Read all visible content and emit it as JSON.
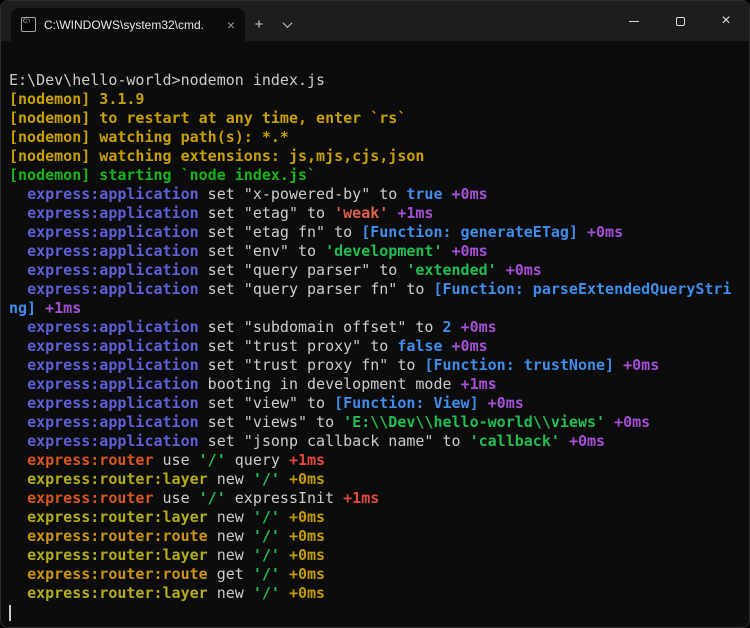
{
  "window": {
    "tab": {
      "title": "C:\\WINDOWS\\system32\\cmd.",
      "icon_label": "C:\\",
      "close_label": "×"
    },
    "controls": {
      "new_tab_label": "+",
      "close_label": "×"
    },
    "icons": {
      "tab_icon": "cmd-prompt-window",
      "dropdown": "chevron-down",
      "minimize": "horizontal-bar",
      "maximize": "outline-square",
      "close": "×"
    }
  },
  "palette": {
    "fg": "#cccccc",
    "yellow": "#c7a000",
    "green": "#18b41c",
    "stringGreen": "#21bd52",
    "nsApp": "#5f5fd7",
    "diffApp": "#a44fd6",
    "blue": "#3f8cea",
    "red": "#e0604c",
    "nsRouter": "#d8551f",
    "diffRed": "#e2483d",
    "nsLayer": "#b2ac19",
    "nsRoute": "#c9930f",
    "diffYellow": "#c19c00"
  },
  "terminal": {
    "lines": [
      {
        "segments": [
          {
            "t": "E:\\Dev\\hello-world>nodemon index.js"
          }
        ]
      },
      {
        "segments": [
          {
            "t": "[nodemon] 3.1.9",
            "c": "yellow",
            "b": 1
          }
        ]
      },
      {
        "segments": [
          {
            "t": "[nodemon] to restart at any time, enter `rs`",
            "c": "yellow",
            "b": 1
          }
        ]
      },
      {
        "segments": [
          {
            "t": "[nodemon] watching path(s): *.*",
            "c": "yellow",
            "b": 1
          }
        ]
      },
      {
        "segments": [
          {
            "t": "[nodemon] watching extensions: js,mjs,cjs,json",
            "c": "yellow",
            "b": 1
          }
        ]
      },
      {
        "segments": [
          {
            "t": "[nodemon] starting `node index.js`",
            "c": "green",
            "b": 1
          }
        ]
      },
      {
        "segments": [
          {
            "t": "  "
          },
          {
            "t": "express:application",
            "c": "nsApp",
            "b": 1
          },
          {
            "t": " set \"x-powered-by\" to "
          },
          {
            "t": "true",
            "c": "blue",
            "b": 1
          },
          {
            "t": " "
          },
          {
            "t": "+0ms",
            "c": "diffApp",
            "b": 1
          }
        ]
      },
      {
        "segments": [
          {
            "t": "  "
          },
          {
            "t": "express:application",
            "c": "nsApp",
            "b": 1
          },
          {
            "t": " set \"etag\" to "
          },
          {
            "t": "'weak'",
            "c": "red",
            "b": 1
          },
          {
            "t": " "
          },
          {
            "t": "+1ms",
            "c": "diffApp",
            "b": 1
          }
        ]
      },
      {
        "segments": [
          {
            "t": "  "
          },
          {
            "t": "express:application",
            "c": "nsApp",
            "b": 1
          },
          {
            "t": " set \"etag fn\" to "
          },
          {
            "t": "[Function: generateETag]",
            "c": "blue",
            "b": 1
          },
          {
            "t": " "
          },
          {
            "t": "+0ms",
            "c": "diffApp",
            "b": 1
          }
        ]
      },
      {
        "segments": [
          {
            "t": "  "
          },
          {
            "t": "express:application",
            "c": "nsApp",
            "b": 1
          },
          {
            "t": " set \"env\" to "
          },
          {
            "t": "'development'",
            "c": "stringGreen",
            "b": 1
          },
          {
            "t": " "
          },
          {
            "t": "+0ms",
            "c": "diffApp",
            "b": 1
          }
        ]
      },
      {
        "segments": [
          {
            "t": "  "
          },
          {
            "t": "express:application",
            "c": "nsApp",
            "b": 1
          },
          {
            "t": " set \"query parser\" to "
          },
          {
            "t": "'extended'",
            "c": "stringGreen",
            "b": 1
          },
          {
            "t": " "
          },
          {
            "t": "+0ms",
            "c": "diffApp",
            "b": 1
          }
        ]
      },
      {
        "segments": [
          {
            "t": "  "
          },
          {
            "t": "express:application",
            "c": "nsApp",
            "b": 1
          },
          {
            "t": " set \"query parser fn\" to "
          },
          {
            "t": "[Function: parseExtendedQueryStri",
            "c": "blue",
            "b": 1
          }
        ]
      },
      {
        "segments": [
          {
            "t": "ng]",
            "c": "blue",
            "b": 1
          },
          {
            "t": " "
          },
          {
            "t": "+1ms",
            "c": "diffApp",
            "b": 1
          }
        ]
      },
      {
        "segments": [
          {
            "t": "  "
          },
          {
            "t": "express:application",
            "c": "nsApp",
            "b": 1
          },
          {
            "t": " set \"subdomain offset\" to "
          },
          {
            "t": "2",
            "c": "blue",
            "b": 1
          },
          {
            "t": " "
          },
          {
            "t": "+0ms",
            "c": "diffApp",
            "b": 1
          }
        ]
      },
      {
        "segments": [
          {
            "t": "  "
          },
          {
            "t": "express:application",
            "c": "nsApp",
            "b": 1
          },
          {
            "t": " set \"trust proxy\" to "
          },
          {
            "t": "false",
            "c": "blue",
            "b": 1
          },
          {
            "t": " "
          },
          {
            "t": "+0ms",
            "c": "diffApp",
            "b": 1
          }
        ]
      },
      {
        "segments": [
          {
            "t": "  "
          },
          {
            "t": "express:application",
            "c": "nsApp",
            "b": 1
          },
          {
            "t": " set \"trust proxy fn\" to "
          },
          {
            "t": "[Function: trustNone]",
            "c": "blue",
            "b": 1
          },
          {
            "t": " "
          },
          {
            "t": "+0ms",
            "c": "diffApp",
            "b": 1
          }
        ]
      },
      {
        "segments": [
          {
            "t": "  "
          },
          {
            "t": "express:application",
            "c": "nsApp",
            "b": 1
          },
          {
            "t": " booting in development mode "
          },
          {
            "t": "+1ms",
            "c": "diffApp",
            "b": 1
          }
        ]
      },
      {
        "segments": [
          {
            "t": "  "
          },
          {
            "t": "express:application",
            "c": "nsApp",
            "b": 1
          },
          {
            "t": " set \"view\" to "
          },
          {
            "t": "[Function: View]",
            "c": "blue",
            "b": 1
          },
          {
            "t": " "
          },
          {
            "t": "+0ms",
            "c": "diffApp",
            "b": 1
          }
        ]
      },
      {
        "segments": [
          {
            "t": "  "
          },
          {
            "t": "express:application",
            "c": "nsApp",
            "b": 1
          },
          {
            "t": " set \"views\" to "
          },
          {
            "t": "'E:\\\\Dev\\\\hello-world\\\\views'",
            "c": "stringGreen",
            "b": 1
          },
          {
            "t": " "
          },
          {
            "t": "+0ms",
            "c": "diffApp",
            "b": 1
          }
        ]
      },
      {
        "segments": [
          {
            "t": "  "
          },
          {
            "t": "express:application",
            "c": "nsApp",
            "b": 1
          },
          {
            "t": " set \"jsonp callback name\" to "
          },
          {
            "t": "'callback'",
            "c": "stringGreen",
            "b": 1
          },
          {
            "t": " "
          },
          {
            "t": "+0ms",
            "c": "diffApp",
            "b": 1
          }
        ]
      },
      {
        "segments": [
          {
            "t": "  "
          },
          {
            "t": "express:router",
            "c": "nsRouter",
            "b": 1
          },
          {
            "t": " use "
          },
          {
            "t": "'/'",
            "c": "stringGreen",
            "b": 1
          },
          {
            "t": " query "
          },
          {
            "t": "+1ms",
            "c": "diffRed",
            "b": 1
          }
        ]
      },
      {
        "segments": [
          {
            "t": "  "
          },
          {
            "t": "express:router:layer",
            "c": "nsLayer",
            "b": 1
          },
          {
            "t": " new "
          },
          {
            "t": "'/'",
            "c": "stringGreen",
            "b": 1
          },
          {
            "t": " "
          },
          {
            "t": "+0ms",
            "c": "diffYellow",
            "b": 1
          }
        ]
      },
      {
        "segments": [
          {
            "t": "  "
          },
          {
            "t": "express:router",
            "c": "nsRouter",
            "b": 1
          },
          {
            "t": " use "
          },
          {
            "t": "'/'",
            "c": "stringGreen",
            "b": 1
          },
          {
            "t": " expressInit "
          },
          {
            "t": "+1ms",
            "c": "diffRed",
            "b": 1
          }
        ]
      },
      {
        "segments": [
          {
            "t": "  "
          },
          {
            "t": "express:router:layer",
            "c": "nsLayer",
            "b": 1
          },
          {
            "t": " new "
          },
          {
            "t": "'/'",
            "c": "stringGreen",
            "b": 1
          },
          {
            "t": " "
          },
          {
            "t": "+0ms",
            "c": "diffYellow",
            "b": 1
          }
        ]
      },
      {
        "segments": [
          {
            "t": "  "
          },
          {
            "t": "express:router:route",
            "c": "nsRoute",
            "b": 1
          },
          {
            "t": " new "
          },
          {
            "t": "'/'",
            "c": "stringGreen",
            "b": 1
          },
          {
            "t": " "
          },
          {
            "t": "+0ms",
            "c": "diffYellow",
            "b": 1
          }
        ]
      },
      {
        "segments": [
          {
            "t": "  "
          },
          {
            "t": "express:router:layer",
            "c": "nsLayer",
            "b": 1
          },
          {
            "t": " new "
          },
          {
            "t": "'/'",
            "c": "stringGreen",
            "b": 1
          },
          {
            "t": " "
          },
          {
            "t": "+0ms",
            "c": "diffYellow",
            "b": 1
          }
        ]
      },
      {
        "segments": [
          {
            "t": "  "
          },
          {
            "t": "express:router:route",
            "c": "nsRoute",
            "b": 1
          },
          {
            "t": " get "
          },
          {
            "t": "'/'",
            "c": "stringGreen",
            "b": 1
          },
          {
            "t": " "
          },
          {
            "t": "+0ms",
            "c": "diffYellow",
            "b": 1
          }
        ]
      },
      {
        "segments": [
          {
            "t": "  "
          },
          {
            "t": "express:router:layer",
            "c": "nsLayer",
            "b": 1
          },
          {
            "t": " new "
          },
          {
            "t": "'/'",
            "c": "stringGreen",
            "b": 1
          },
          {
            "t": " "
          },
          {
            "t": "+0ms",
            "c": "diffYellow",
            "b": 1
          }
        ]
      },
      {
        "segments": [],
        "cursor": true
      }
    ]
  }
}
